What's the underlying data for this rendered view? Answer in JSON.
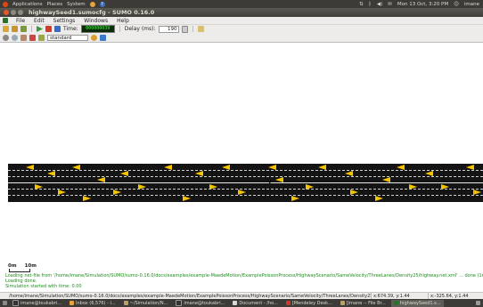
{
  "top_panel": {
    "menus": [
      "Applications",
      "Places",
      "System"
    ],
    "clock": "Mon 13 Oct,  3:20 PM",
    "user": "imane"
  },
  "window": {
    "title": "highwaySeed1.sumocfg - SUMO 0.16.0"
  },
  "menubar": {
    "items": [
      "File",
      "Edit",
      "Settings",
      "Windows",
      "Help"
    ]
  },
  "toolbar": {
    "time_label": "Time:",
    "time_value": "000000039",
    "delay_label": "Delay (ms):",
    "delay_value": "190",
    "scheme_value": "standard"
  },
  "scale": {
    "zero": "0m",
    "ten": "10m"
  },
  "log": {
    "line1": "Loading net-file from '/home/imane/Simulation/SUMO/sumo-0.16.0/docs/examples/example-MaedeMotion/ExamplePoissonProcess/HighwayScenario/SameVelocity/ThreeLanes/Density25/highway.net.xml' ... done (1ms).",
    "line2": "Loading done.",
    "line3": "Simulation started with time: 0.00"
  },
  "statusbar": {
    "path": "/home/imane/Simulation/SUMO/sumo-0.16.0/docs/examples/example-MaedeMotion/ExamplePoissonProcess/HighwayScenario/SameVelocity/ThreeLanes/Density25/highv",
    "coord1": "x:674.39, y:1.44",
    "coord2": "x:-325.64, y:1.44"
  },
  "taskbar": {
    "items": [
      "imane@toukabri...",
      "Inbox (6,576) - i...",
      "~/Simulation/N...",
      "imane@toukabri...",
      "Document - /ho...",
      "[Mendeley Desk...",
      "[imane -- File Br...",
      "highwaySeed1.s..."
    ]
  },
  "colors": {
    "vehicle": "#f5c400",
    "road": "#141414",
    "log_text": "#1a8f1a"
  }
}
